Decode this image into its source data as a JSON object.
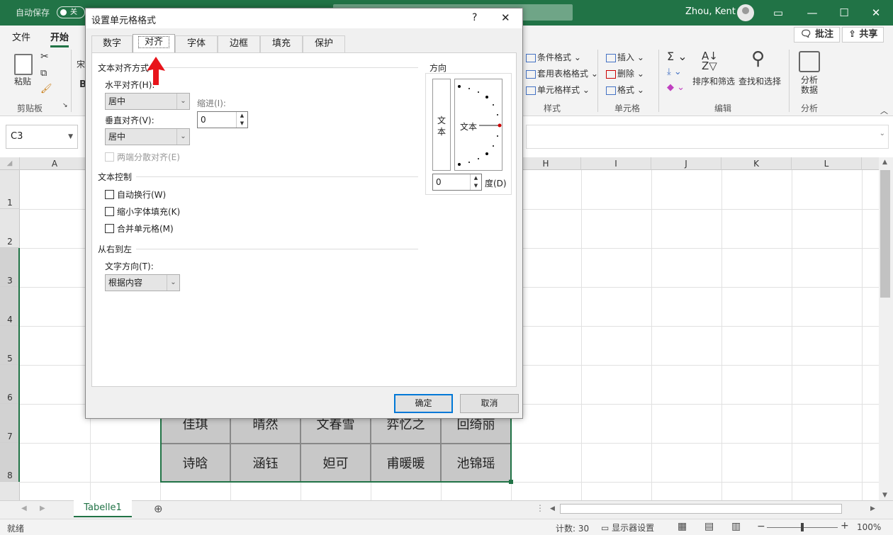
{
  "titlebar": {
    "autosave_label": "自动保存",
    "autosave_state": "关",
    "user_name": "Zhou, Kent",
    "win_buttons": [
      "▭",
      "—",
      "☐",
      "✕"
    ]
  },
  "ribbon": {
    "tabs": [
      "文件",
      "开始"
    ],
    "font_trunc": "宋",
    "paste_label": "粘贴",
    "clipboard_group": "剪贴板",
    "bold_label": "B",
    "cond_format": "条件格式",
    "table_format": "套用表格格式",
    "cell_style": "单元格样式",
    "styles_group": "样式",
    "insert": "插入",
    "delete": "删除",
    "format": "格式",
    "cells_group": "单元格",
    "sort_filter": "排序和筛选",
    "find_select": "查找和选择",
    "editing_group": "编辑",
    "analyze_line1": "分析",
    "analyze_line2": "数据",
    "analysis_group": "分析",
    "comments_button": "批注",
    "share_button": "共享"
  },
  "formula_bar": {
    "name_box": "C3"
  },
  "columns": [
    "A",
    "H",
    "I",
    "J",
    "K",
    "L"
  ],
  "rows": [
    "1",
    "2",
    "3",
    "4",
    "5",
    "6",
    "7",
    "8"
  ],
  "cells_row7": [
    "佳琪",
    "晴然",
    "文春雪",
    "弈忆之",
    "回绮丽"
  ],
  "cells_row8": [
    "诗晗",
    "涵钰",
    "妲可",
    "甫暖暖",
    "池锦瑶"
  ],
  "sheet_tab": "Tabelle1",
  "status": {
    "ready": "就绪",
    "count": "计数: 30",
    "display_settings": "显示器设置",
    "zoom": "100%"
  },
  "dialog": {
    "title": "设置单元格格式",
    "help": "?",
    "close": "✕",
    "tabs": [
      "数字",
      "对齐",
      "字体",
      "边框",
      "填充",
      "保护"
    ],
    "active_tab": "对齐",
    "text_align_section": "文本对齐方式",
    "h_align_label": "水平对齐(H):",
    "h_align_value": "居中",
    "v_align_label": "垂直对齐(V):",
    "v_align_value": "居中",
    "indent_label": "缩进(I):",
    "indent_value": "0",
    "justify_distributed": "两端分散对齐(E)",
    "text_control_section": "文本控制",
    "wrap_text": "自动换行(W)",
    "shrink_to_fit": "缩小字体填充(K)",
    "merge_cells": "合并单元格(M)",
    "rtl_section": "从右到左",
    "text_direction_label": "文字方向(T):",
    "text_direction_value": "根据内容",
    "orientation_section": "方向",
    "vertical_text": "文本",
    "orient_text": "文本",
    "degree_value": "0",
    "degree_label": "度(D)",
    "ok_button": "确定",
    "cancel_button": "取消"
  },
  "colors": {
    "excel_green": "#217346",
    "selection": "#217346",
    "arrow_red": "#e8141b",
    "primary_border": "#0078d7"
  }
}
